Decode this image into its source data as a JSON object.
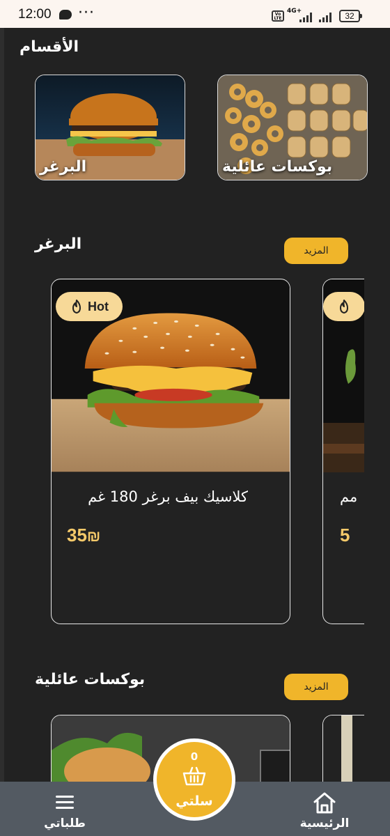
{
  "status_bar": {
    "time": "12:00",
    "dots": "···",
    "network": "4G+",
    "volte": "Vo LTE",
    "battery": "32"
  },
  "categories": {
    "title": "الأقسام",
    "items": [
      {
        "label": "البرغر"
      },
      {
        "label": "بوكسات عائلية"
      }
    ]
  },
  "burger_section": {
    "title": "البرغر",
    "more_label": "المزيد",
    "products": [
      {
        "badge": "Hot",
        "name": "كلاسيك بيف برغر 180 غم",
        "price": "35",
        "currency": "₪"
      }
    ],
    "peek": {
      "name": "مم",
      "price": "5"
    }
  },
  "family_section": {
    "title": "بوكسات عائلية",
    "more_label": "المزيد"
  },
  "bottom_nav": {
    "home_label": "الرئيسية",
    "cart_label": "سلتي",
    "cart_count": "0",
    "orders_label": "طلباتي"
  },
  "colors": {
    "background": "#222222",
    "accent": "#f0b52a",
    "price": "#f4c96a",
    "hot_badge": "#f7d998",
    "nav": "#535a62"
  }
}
